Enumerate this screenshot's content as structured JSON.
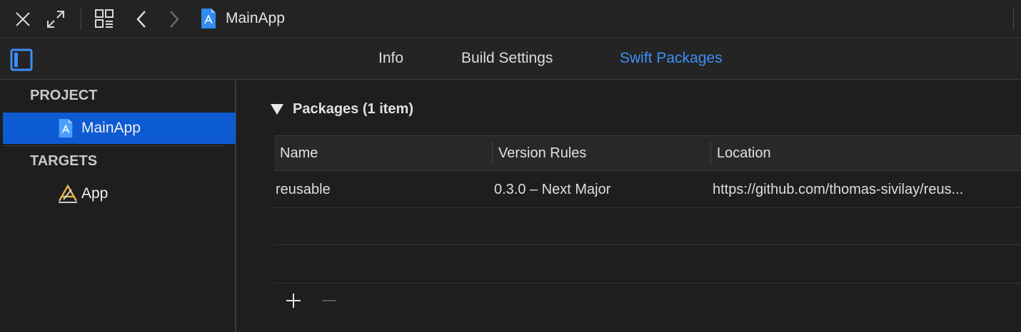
{
  "window": {
    "breadcrumb_title": "MainApp"
  },
  "toolbar": {
    "icons": [
      "close-icon",
      "expand-icon",
      "related-items-icon",
      "back-icon",
      "forward-icon",
      "xcode-project-icon"
    ]
  },
  "tabs": [
    {
      "label": "Info",
      "active": false
    },
    {
      "label": "Build Settings",
      "active": false
    },
    {
      "label": "Swift Packages",
      "active": true
    }
  ],
  "sidebar": {
    "project_header": "PROJECT",
    "project_item": "MainApp",
    "targets_header": "TARGETS",
    "target_item": "App"
  },
  "packages": {
    "title": "Packages (1 item)",
    "columns": [
      "Name",
      "Version Rules",
      "Location"
    ],
    "rows": [
      {
        "name": "reusable",
        "version_rules": "0.3.0 – Next Major",
        "location": "https://github.com/thomas-sivilay/reus..."
      }
    ]
  },
  "colors": {
    "accent": "#3e8ef7",
    "selection": "#0d5bd3",
    "background": "#1e1e1e"
  }
}
